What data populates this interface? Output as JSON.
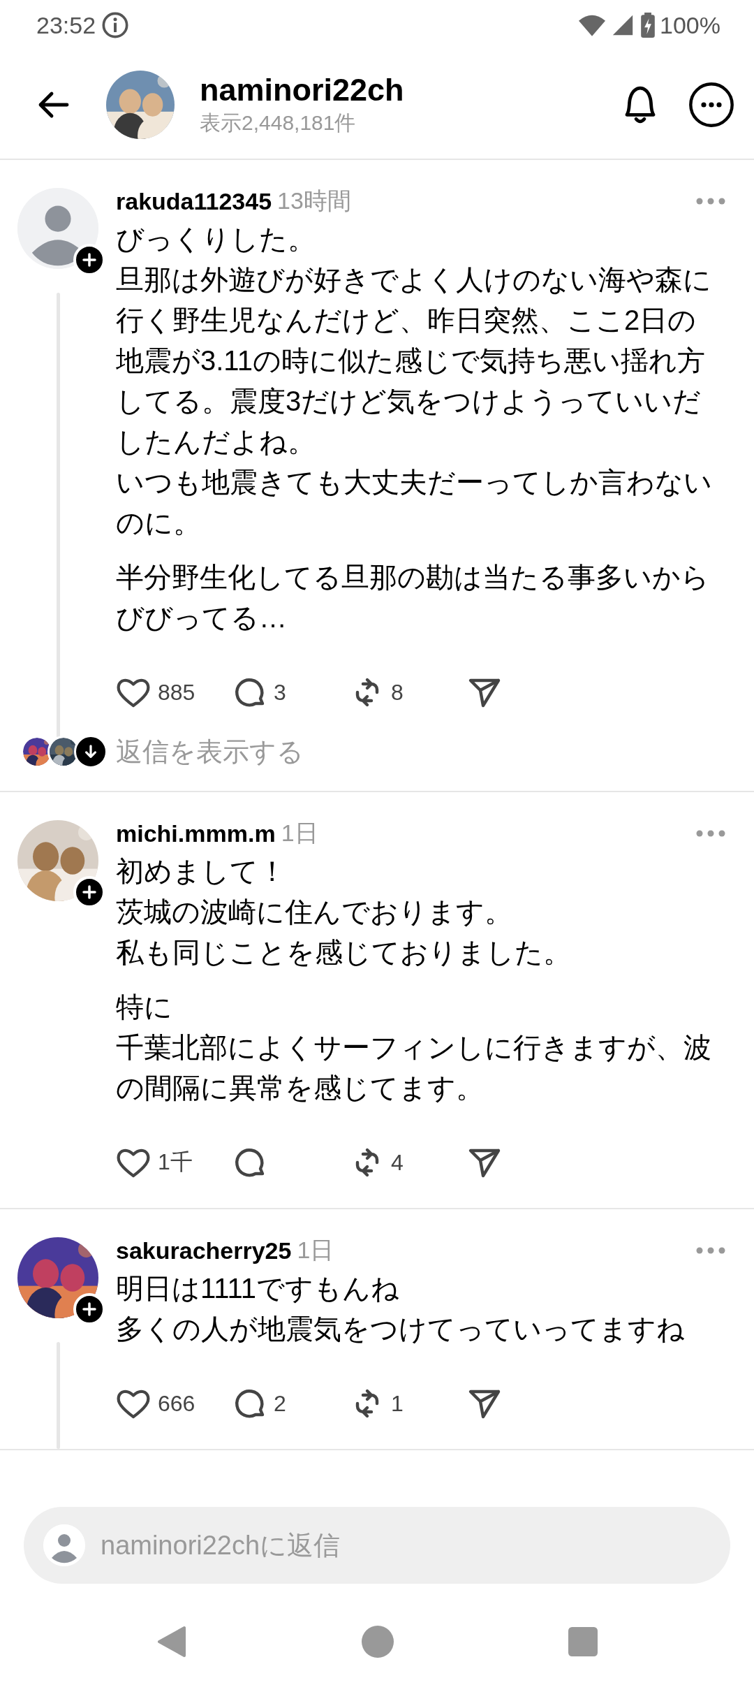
{
  "status_bar": {
    "time": "23:52",
    "battery": "100%"
  },
  "header": {
    "username": "naminori22ch",
    "views": "表示2,448,181件",
    "avatar": {
      "kind": "picture"
    }
  },
  "posts": [
    {
      "username": "rakuda112345",
      "time": "13時間",
      "avatar": {
        "kind": "default"
      },
      "thread_line": true,
      "paragraphs": [
        [
          "びっくりした。",
          "旦那は外遊びが好きでよく人けのない海や森に",
          "行く野生児なんだけど、昨日突然、ここ2日の",
          "地震が3.11の時に似た感じで気持ち悪い揺れ方",
          "してる。震度3だけど気をつけようっていいだ",
          "したんだよね。",
          "いつも地震きても大丈夫だーってしか言わない",
          "のに。"
        ],
        [
          "半分野生化してる旦那の勘は当たる事多いから",
          "びびってる…"
        ]
      ],
      "actions": [
        {
          "kind": "like",
          "count": "885"
        },
        {
          "kind": "reply",
          "count": "3"
        },
        {
          "kind": "repost",
          "count": "8"
        },
        {
          "kind": "share"
        }
      ],
      "show_replies": {
        "label": "返信を表示する"
      }
    },
    {
      "username": "michi.mmm.m",
      "time": "1日",
      "avatar": {
        "kind": "picture"
      },
      "thread_line": false,
      "paragraphs": [
        [
          "初めまして！",
          "茨城の波崎に住んでおります。",
          "私も同じことを感じておりました。"
        ],
        [
          "特に",
          "千葉北部によくサーフィンしに行きますが、波",
          "の間隔に異常を感じてます。"
        ]
      ],
      "actions": [
        {
          "kind": "like",
          "count": "1千"
        },
        {
          "kind": "reply"
        },
        {
          "kind": "repost",
          "count": "4"
        },
        {
          "kind": "share"
        }
      ]
    },
    {
      "username": "sakuracherry25",
      "time": "1日",
      "avatar": {
        "kind": "picture"
      },
      "thread_line": true,
      "paragraphs": [
        [
          "明日は1111ですもんね",
          "多くの人が地震気をつけてっていってますね"
        ]
      ],
      "actions": [
        {
          "kind": "like",
          "count": "666"
        },
        {
          "kind": "reply",
          "count": "2"
        },
        {
          "kind": "repost",
          "count": "1"
        },
        {
          "kind": "share"
        }
      ]
    }
  ],
  "composer": {
    "placeholder": "naminori22chに返信"
  }
}
